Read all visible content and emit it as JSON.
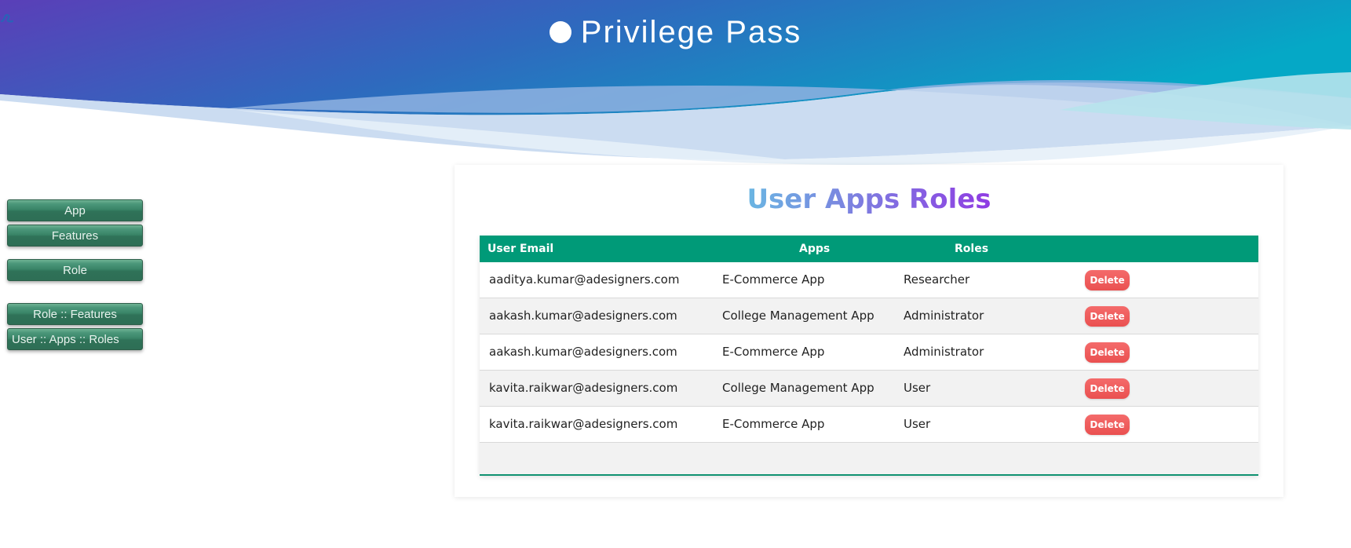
{
  "brand": {
    "title": "Privilege Pass"
  },
  "colors": {
    "header_gradient_start": "#5a3fb8",
    "header_gradient_end": "#05a8c6",
    "table_header": "#009a78",
    "sidebar_button": "#3a8568",
    "delete_button": "#ef5c5c"
  },
  "sidebar": {
    "items": [
      {
        "label": "App"
      },
      {
        "label": "Features"
      },
      {
        "label": "Role"
      },
      {
        "label": "Role :: Features"
      },
      {
        "label": "User :: Apps :: Roles"
      }
    ]
  },
  "main": {
    "title": "User Apps Roles",
    "table": {
      "columns": [
        "User Email",
        "Apps",
        "Roles"
      ],
      "delete_label": "Delete",
      "rows": [
        {
          "email": "aaditya.kumar@adesigners.com",
          "app": "E-Commerce App",
          "role": "Researcher"
        },
        {
          "email": "aakash.kumar@adesigners.com",
          "app": "College Management App",
          "role": "Administrator"
        },
        {
          "email": "aakash.kumar@adesigners.com",
          "app": "E-Commerce App",
          "role": "Administrator"
        },
        {
          "email": "kavita.raikwar@adesigners.com",
          "app": "College Management App",
          "role": "User"
        },
        {
          "email": "kavita.raikwar@adesigners.com",
          "app": "E-Commerce App",
          "role": "User"
        }
      ]
    }
  }
}
